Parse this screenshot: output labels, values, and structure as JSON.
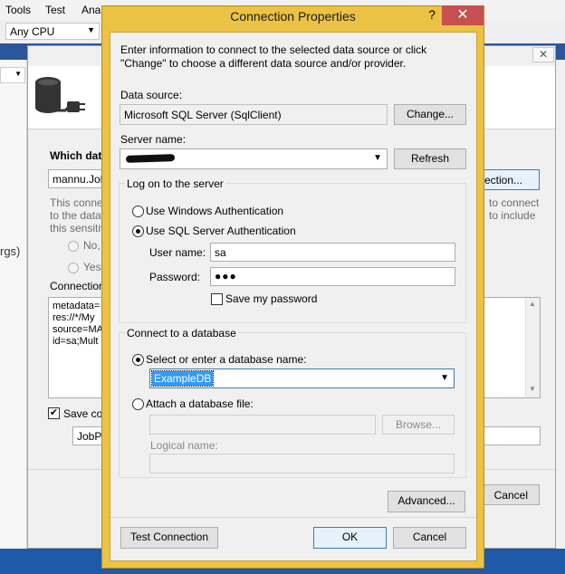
{
  "vs": {
    "menu": [
      "Tools",
      "Test",
      "Anal"
    ],
    "platform_combo": "Any CPU",
    "left_fragment": "rgs)"
  },
  "wizard": {
    "which_label": "Which data",
    "connection_combo": "mannu.Job",
    "new_connection_button": "ection...",
    "right_text_1": "to connect",
    "right_text_2": "to include",
    "left_text_1": "This connec",
    "left_text_2": "to the datab",
    "left_text_3": "this sensitiv",
    "radio_no": "No,",
    "radio_yes": "Yes",
    "connection_string_label": "Connection",
    "connection_string_lines": [
      "metadata=",
      "res://*/My",
      "source=MA",
      "id=sa;Mult"
    ],
    "save_label": "Save co",
    "entity_name": "JobPo",
    "cancel_button": "Cancel",
    "close_glyph": "✕"
  },
  "dialog": {
    "title": "Connection Properties",
    "help_glyph": "?",
    "close_glyph": "✕",
    "intro": "Enter information to connect to the selected data source or click \"Change\" to choose a different data source and/or provider.",
    "data_source_label": "Data source:",
    "data_source_value": "Microsoft SQL Server (SqlClient)",
    "change_button": "Change...",
    "server_name_label": "Server name:",
    "refresh_button": "Refresh",
    "logon_group": "Log on to the server",
    "windows_auth": "Use Windows Authentication",
    "sql_auth": "Use SQL Server Authentication",
    "user_name_label": "User name:",
    "user_name_value": "sa",
    "password_label": "Password:",
    "password_value": "●●●",
    "save_password": "Save my password",
    "db_group": "Connect to a database",
    "select_db_label": "Select or enter a database name:",
    "db_name_value": "ExampleDB",
    "attach_file_label": "Attach a database file:",
    "browse_button": "Browse...",
    "logical_name_label": "Logical name:",
    "advanced_button": "Advanced...",
    "test_button": "Test Connection",
    "ok_button": "OK",
    "cancel_button": "Cancel"
  }
}
